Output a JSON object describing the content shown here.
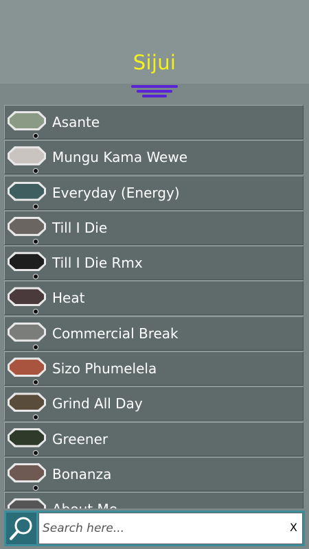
{
  "header": {
    "title": "Sijui"
  },
  "colors": {
    "title": "#f4f21c",
    "menu_icon": "#5a23d6",
    "list_item_bg": "#5e6b6a",
    "search_bar_bg": "#3b8d9b"
  },
  "songs": [
    {
      "title": "Asante",
      "thumb_color": "#8a9a84"
    },
    {
      "title": "Mungu Kama Wewe",
      "thumb_color": "#c9c4bf"
    },
    {
      "title": "Everyday (Energy)",
      "thumb_color": "#3e5e5f"
    },
    {
      "title": "Till I Die",
      "thumb_color": "#6b6561"
    },
    {
      "title": "Till I Die Rmx",
      "thumb_color": "#1e1e1e"
    },
    {
      "title": "Heat",
      "thumb_color": "#4a3a3c"
    },
    {
      "title": "Commercial Break",
      "thumb_color": "#7b7d7a"
    },
    {
      "title": "Sizo Phumelela",
      "thumb_color": "#a8543e"
    },
    {
      "title": "Grind All Day",
      "thumb_color": "#5a4c3a"
    },
    {
      "title": "Greener",
      "thumb_color": "#2f3b2a"
    },
    {
      "title": "Bonanza",
      "thumb_color": "#6e5a52"
    },
    {
      "title": "About Me",
      "thumb_color": "#555555"
    }
  ],
  "search": {
    "placeholder": "Search here...",
    "clear_label": "X",
    "icon": "search-icon"
  }
}
